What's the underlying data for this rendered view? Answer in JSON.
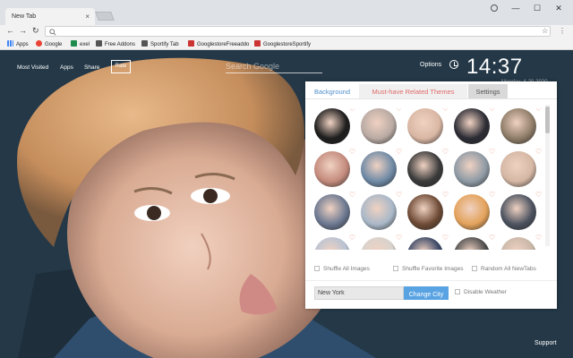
{
  "window": {
    "tab_title": "New Tab",
    "tab_close": "×",
    "controls": [
      "—",
      "☐",
      "✕"
    ]
  },
  "toolbar": {
    "back": "←",
    "forward": "→",
    "reload": "↻",
    "star": "☆",
    "menu": "⋮"
  },
  "bookmarks": [
    {
      "label": "Apps",
      "color": "#4285f4"
    },
    {
      "label": "Google",
      "color": "#ea4335"
    },
    {
      "label": "exel",
      "color": "#1f8b4c"
    },
    {
      "label": "Free Addons",
      "color": "#555555"
    },
    {
      "label": "Sportify Tab",
      "color": "#555555"
    },
    {
      "label": "GooglestoreFreeaddo",
      "color": "#c33"
    },
    {
      "label": "GooglestoreSportify",
      "color": "#c33"
    }
  ],
  "page": {
    "nav": [
      "Most Visited",
      "Apps",
      "Share",
      "Rate"
    ],
    "search_placeholder": "Search Google",
    "options_label": "Options",
    "time": "14:37",
    "date": "Monday, 4-20-2020",
    "support": "Support"
  },
  "panel": {
    "tabs": [
      "Background",
      "Must-have Related Themes",
      "Settings"
    ],
    "checkboxes": [
      "Shuffle All Images",
      "Shuffle Favorite Images",
      "Random All NewTabs"
    ],
    "city_value": "New York",
    "change_city_label": "Change City",
    "disable_weather_label": "Disable Weather",
    "thumbnail_colors": [
      [
        "#1d1d1d",
        "#b9aaa3",
        "#d9b7a4",
        "#2c2c35",
        "#8f7d68"
      ],
      [
        "#c48b7d",
        "#6f8aa6",
        "#3b3b3b",
        "#8e9aa5",
        "#d5b7a4"
      ],
      [
        "#6b7891",
        "#a9b8c8",
        "#6e4b36",
        "#e3a25b",
        "#4c5360"
      ],
      [
        "#b9c3d3",
        "#d8d2cd",
        "#3a4766",
        "#4d4d4d",
        "#c9b7a8"
      ]
    ],
    "heart": "♡"
  }
}
